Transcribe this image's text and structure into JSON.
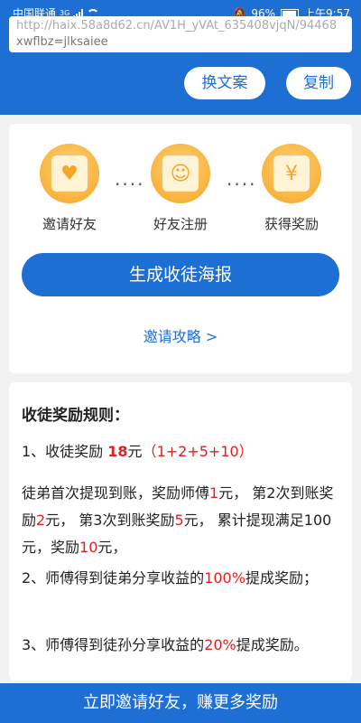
{
  "status_bar": {
    "carrier": "中国联通",
    "network": "3G",
    "battery": "96%",
    "time": "上午9:57"
  },
  "invite_link": {
    "line1": "http://haix.58a8d62.cn/AV1H_yVAt_635408vjqN/94468",
    "line2": "xwflbz=jlksaiee"
  },
  "actions": {
    "change_copy": "换文案",
    "copy": "复制"
  },
  "steps": [
    {
      "label": "邀请好友",
      "icon": "envelope-heart-icon"
    },
    {
      "label": "好友注册",
      "icon": "id-badge-icon"
    },
    {
      "label": "获得奖励",
      "icon": "money-bag-icon"
    }
  ],
  "dots": "····",
  "generate_button": "生成收徒海报",
  "strategy_link": "邀请攻略 >",
  "rules": {
    "title": "收徒奖励规则：",
    "rule1_prefix": "1、收徒奖励 ",
    "rule1_amount": "18",
    "rule1_unit": "元",
    "rule1_breakdown": "（1+2+5+10）",
    "detail_a": "徒弟首次提现到账，奖励师傅",
    "detail_n1": "1",
    "detail_b": "元， 第2次到账奖励",
    "detail_n2": "2",
    "detail_c": "元， 第3次到账奖励",
    "detail_n3": "5",
    "detail_d": "元， 累计提现满足100元，奖励",
    "detail_n4": "10",
    "detail_e": "元，",
    "rule2_a": "2、师傅得到徒弟分享收益的",
    "rule2_pct": "100%",
    "rule2_b": "提成奖励；",
    "rule3_a": "3、师傅得到徒孙分享收益的",
    "rule3_pct": "20%",
    "rule3_b": "提成奖励。"
  },
  "bottom_cta": "立即邀请好友，赚更多奖励",
  "colors": {
    "primary": "#1e6fd4",
    "accent_red": "#e02020",
    "icon_orange": "#f5a623"
  }
}
